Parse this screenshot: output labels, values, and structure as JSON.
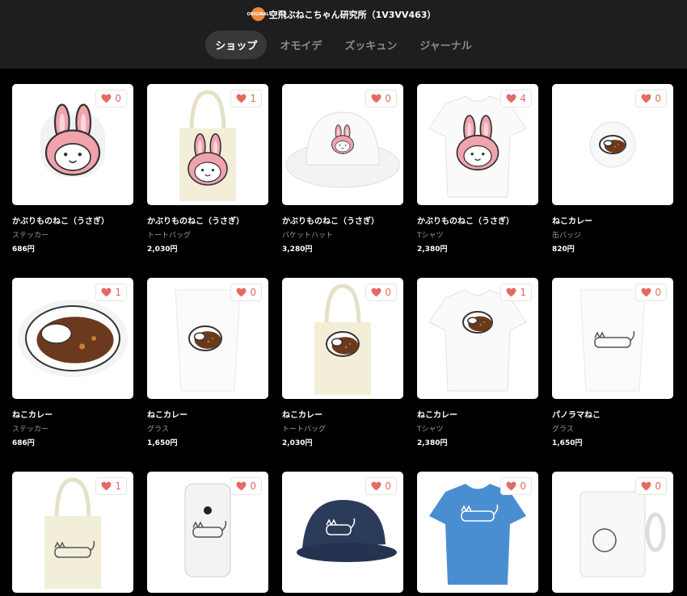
{
  "shop": {
    "title": "空飛ぶねこちゃん研究所（1V3VV463）",
    "logo_text": "ORIGINAL"
  },
  "tabs": [
    {
      "label": "ショップ",
      "active": true
    },
    {
      "label": "オモイデ",
      "active": false
    },
    {
      "label": "ズッキュン",
      "active": false
    },
    {
      "label": "ジャーナル",
      "active": false
    }
  ],
  "products": [
    {
      "name": "かぶりものねこ（うさぎ）",
      "type": "ステッカー",
      "price": "686円",
      "likes": "0",
      "art": "sticker-bunny"
    },
    {
      "name": "かぶりものねこ（うさぎ）",
      "type": "トートバッグ",
      "price": "2,030円",
      "likes": "1",
      "art": "tote-bunny"
    },
    {
      "name": "かぶりものねこ（うさぎ）",
      "type": "バケットハット",
      "price": "3,280円",
      "likes": "0",
      "art": "hat-bunny"
    },
    {
      "name": "かぶりものねこ（うさぎ）",
      "type": "Tシャツ",
      "price": "2,380円",
      "likes": "4",
      "art": "tshirt-bunny"
    },
    {
      "name": "ねこカレー",
      "type": "缶バッジ",
      "price": "820円",
      "likes": "0",
      "art": "badge-curry"
    },
    {
      "name": "ねこカレー",
      "type": "ステッカー",
      "price": "686円",
      "likes": "1",
      "art": "sticker-curry"
    },
    {
      "name": "ねこカレー",
      "type": "グラス",
      "price": "1,650円",
      "likes": "0",
      "art": "glass-curry"
    },
    {
      "name": "ねこカレー",
      "type": "トートバッグ",
      "price": "2,030円",
      "likes": "0",
      "art": "tote-curry"
    },
    {
      "name": "ねこカレー",
      "type": "Tシャツ",
      "price": "2,380円",
      "likes": "1",
      "art": "tshirt-curry"
    },
    {
      "name": "パノラマねこ",
      "type": "グラス",
      "price": "1,650円",
      "likes": "0",
      "art": "glass-cat"
    },
    {
      "name": "",
      "type": "",
      "price": "",
      "likes": "1",
      "art": "tote-cat"
    },
    {
      "name": "",
      "type": "",
      "price": "",
      "likes": "0",
      "art": "phone-cat"
    },
    {
      "name": "",
      "type": "",
      "price": "",
      "likes": "0",
      "art": "cap-cat"
    },
    {
      "name": "",
      "type": "",
      "price": "",
      "likes": "0",
      "art": "tshirt-blue-cat"
    },
    {
      "name": "",
      "type": "",
      "price": "",
      "likes": "0",
      "art": "mug-cat"
    }
  ],
  "colors": {
    "accent": "#e36a61",
    "header_bg": "#1e1e1e",
    "page_bg": "#000000"
  }
}
